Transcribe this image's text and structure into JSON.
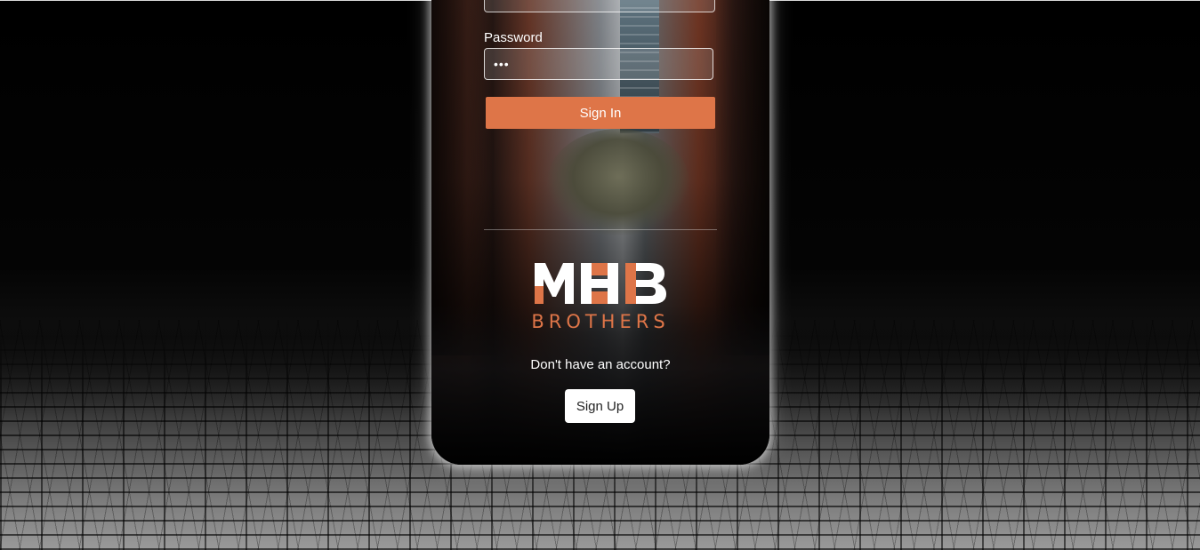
{
  "form": {
    "password_label": "Password",
    "password_value": "•••",
    "signin_label": "Sign In"
  },
  "brand": {
    "logo_text": "MHB",
    "logo_subtext": "BROTHERS",
    "accent_color": "#de7548"
  },
  "signup": {
    "prompt": "Don't have an account?",
    "button_label": "Sign Up"
  }
}
